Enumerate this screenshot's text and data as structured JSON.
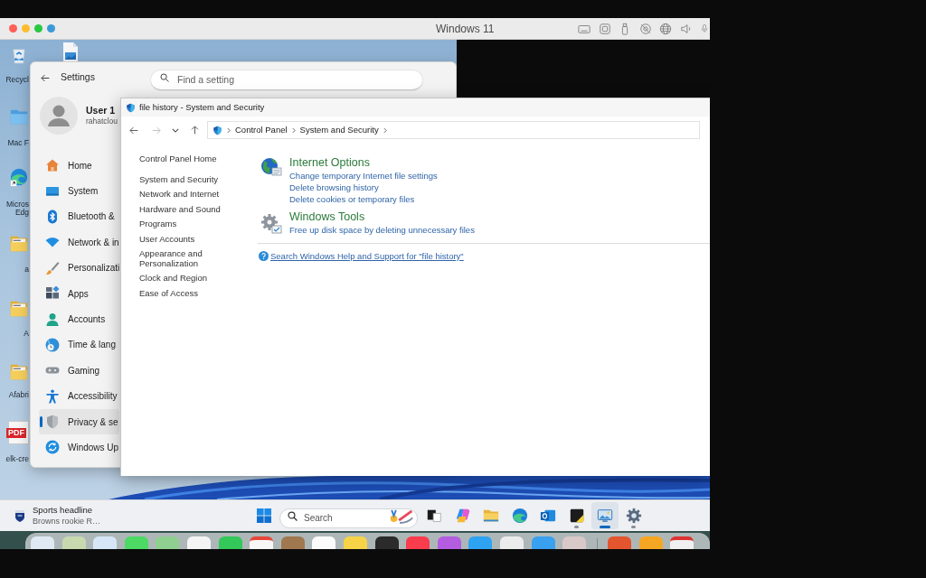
{
  "host_window": {
    "title": "Windows 11"
  },
  "desktop_icons": [
    {
      "kind": "recycle-bin",
      "label": "Recycl"
    },
    {
      "kind": "image-file"
    },
    {
      "kind": "mac-folder",
      "label": "Mac F"
    },
    {
      "kind": "browser",
      "label": "Micros Edg"
    },
    {
      "kind": "folder",
      "label": "a"
    },
    {
      "kind": "folder",
      "label": "A"
    },
    {
      "kind": "folder",
      "label": "Afabri"
    },
    {
      "kind": "pdf",
      "badge": "PDF",
      "label": "elk-cre"
    }
  ],
  "settings": {
    "title": "Settings",
    "search": {
      "placeholder": "Find a setting"
    },
    "user": {
      "name": "User 1",
      "account": "rahatclou"
    },
    "nav": [
      {
        "kind": "home",
        "label": "Home",
        "selected": false
      },
      {
        "kind": "system",
        "label": "System",
        "selected": false
      },
      {
        "kind": "bluetooth",
        "label": "Bluetooth &",
        "selected": false
      },
      {
        "kind": "network",
        "label": "Network & in",
        "selected": false
      },
      {
        "kind": "personalization",
        "label": "Personalizati",
        "selected": false
      },
      {
        "kind": "apps",
        "label": "Apps",
        "selected": false
      },
      {
        "kind": "accounts",
        "label": "Accounts",
        "selected": false
      },
      {
        "kind": "time",
        "label": "Time & lang",
        "selected": false
      },
      {
        "kind": "gaming",
        "label": "Gaming",
        "selected": false
      },
      {
        "kind": "accessibility",
        "label": "Accessibility",
        "selected": false
      },
      {
        "kind": "privacy",
        "label": "Privacy & se",
        "selected": true
      },
      {
        "kind": "update",
        "label": "Windows Up",
        "selected": false
      }
    ]
  },
  "control_panel": {
    "title": "file history - System and Security",
    "nav_buttons": [
      {
        "kind": "back",
        "disabled": false
      },
      {
        "kind": "forward",
        "disabled": true
      },
      {
        "kind": "recent",
        "disabled": false
      },
      {
        "kind": "up",
        "disabled": false
      }
    ],
    "breadcrumb": [
      "Control Panel",
      "System and Security"
    ],
    "sidebar": {
      "home": "Control Panel Home",
      "links": [
        "System and Security",
        "Network and Internet",
        "Hardware and Sound",
        "Programs",
        "User Accounts",
        "Appearance and Personalization",
        "Clock and Region",
        "Ease of Access"
      ]
    },
    "results": [
      {
        "kind": "internet",
        "title": "Internet Options",
        "links": [
          "Change temporary Internet file settings",
          "Delete browsing history",
          "Delete cookies or temporary files"
        ]
      },
      {
        "kind": "tools",
        "title": "Windows Tools",
        "links": [
          "Free up disk space by deleting unnecessary files"
        ]
      }
    ],
    "help_link": "Search Windows Help and Support for \"file history\""
  },
  "taskbar": {
    "news": {
      "title": "Sports headline",
      "subtitle": "Browns rookie R…"
    },
    "search": {
      "placeholder": "Search"
    },
    "apps": [
      {
        "kind": "taskview",
        "running": false,
        "selected": false
      },
      {
        "kind": "copilot",
        "running": false,
        "selected": false
      },
      {
        "kind": "explorer",
        "running": false,
        "selected": false
      },
      {
        "kind": "browser",
        "running": false,
        "selected": false
      },
      {
        "kind": "mail",
        "running": false,
        "selected": false
      },
      {
        "kind": "notes",
        "running": true,
        "selected": false
      },
      {
        "kind": "controlpanel",
        "running": true,
        "selected": true
      },
      {
        "kind": "settings",
        "running": true,
        "selected": false
      }
    ]
  }
}
